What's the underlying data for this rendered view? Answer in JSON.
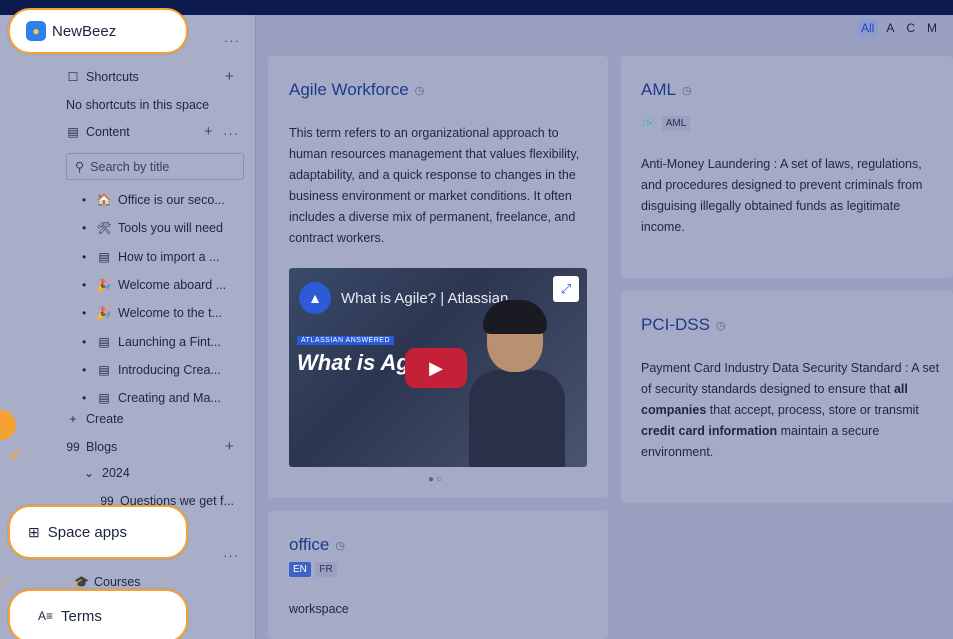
{
  "app": {
    "name": "NewBeez"
  },
  "filters": {
    "all": "All",
    "a": "A",
    "c": "C",
    "m": "M"
  },
  "sidebar": {
    "shortcuts_label": "Shortcuts",
    "shortcuts_empty": "No shortcuts in this space",
    "content_label": "Content",
    "search_placeholder": "Search by title",
    "items": [
      {
        "icon": "🏠",
        "label": "Office is our seco..."
      },
      {
        "icon": "🛠",
        "label": "Tools you will need"
      },
      {
        "icon": "▤",
        "label": "How to import a ..."
      },
      {
        "icon": "🎉",
        "label": "Welcome aboard ..."
      },
      {
        "icon": "🎉",
        "label": "Welcome to the t..."
      },
      {
        "icon": "▤",
        "label": "Launching a Fint..."
      },
      {
        "icon": "▤",
        "label": "Introducing Crea..."
      },
      {
        "icon": "▤",
        "label": "Creating and Ma..."
      }
    ],
    "create_label": "Create",
    "blogs_label": "Blogs",
    "year_label": "2024",
    "blog_item": "Questions we get f...",
    "courses_label": "Courses"
  },
  "callouts": {
    "space_apps": "Space apps",
    "terms": "Terms"
  },
  "cards": {
    "agile": {
      "title": "Agile Workforce",
      "body": "This term refers to an organizational approach to human resources management that values flexibility, adaptability, and a quick response to changes in the business environment or market conditions. It often includes a diverse mix of permanent, freelance, and contract workers.",
      "video_title": "What is Agile? | Atlassian ...",
      "video_badge": "ATLASSIAN ANSWERED",
      "video_caption": "What is Ag"
    },
    "aml": {
      "title": "AML",
      "tag": "AML",
      "body": "Anti-Money Laundering : A set of laws, regulations, and procedures designed to prevent criminals from disguising illegally obtained funds as legitimate income."
    },
    "pci": {
      "title": "PCI-DSS",
      "body_1": "Payment Card Industry Data Security Standard : A set of security standards designed to ensure that ",
      "body_bold_1": "all companies",
      "body_2": " that accept, process, store or transmit ",
      "body_bold_2": "credit card information",
      "body_3": " maintain a secure environment."
    },
    "office": {
      "title": "office",
      "tag_en": "EN",
      "tag_fr": "FR",
      "body": "workspace"
    }
  }
}
